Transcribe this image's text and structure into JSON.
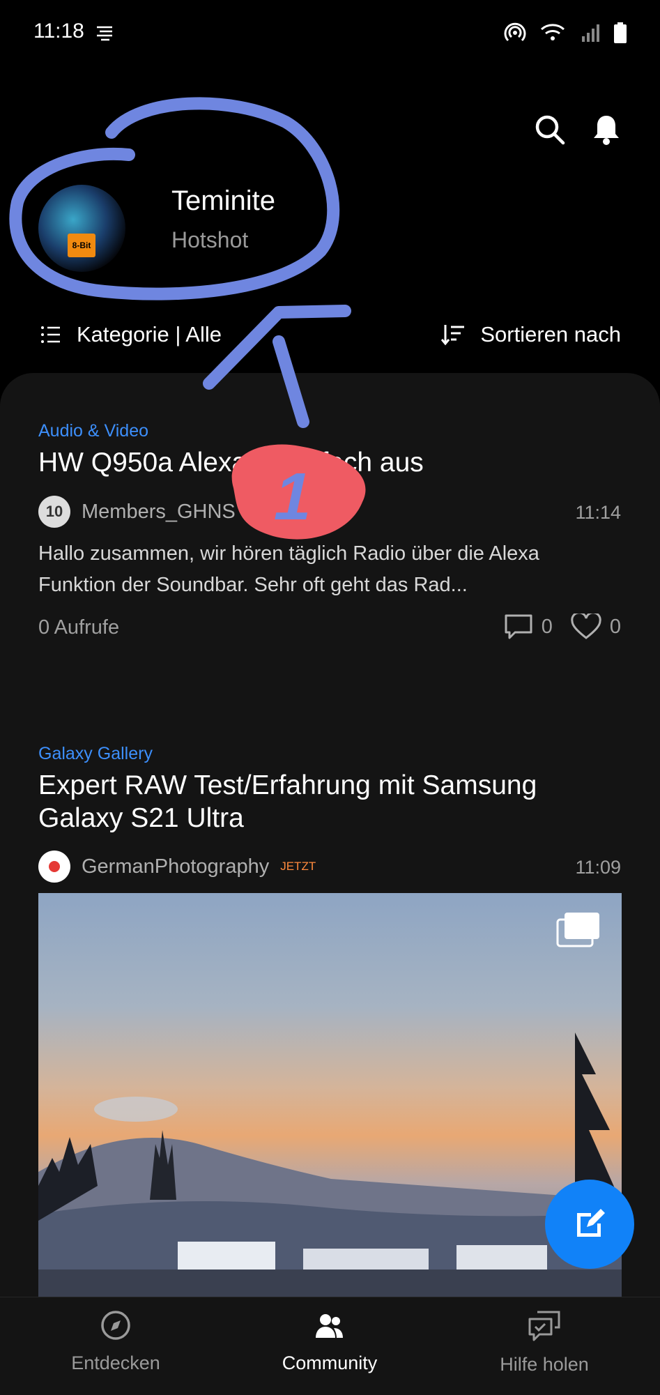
{
  "status_bar": {
    "time": "11:18"
  },
  "header": {
    "username": "Teminite",
    "rank": "Hotshot",
    "avatar_tag": "8-Bit"
  },
  "toolbar": {
    "category_label": "Kategorie | Alle",
    "sort_label": "Sortieren nach"
  },
  "posts": [
    {
      "category": "Audio & Video",
      "title": "HW Q950a Alexa ... einfach aus",
      "author": "Members_GHNS",
      "time": "11:14",
      "excerpt": "Hallo zusammen, wir hören täglich Radio über die Alexa Funktion der Soundbar. Sehr oft geht das Rad...",
      "views": "0 Aufrufe",
      "comments": "0",
      "likes": "0"
    },
    {
      "category": "Galaxy Gallery",
      "title": "Expert RAW Test/Erfahrung mit Samsung Galaxy S21 Ultra",
      "author": "GermanPhotography",
      "badge": "JETZT",
      "time": "11:09"
    }
  ],
  "annotation": {
    "number": "1"
  },
  "nav": {
    "items": [
      {
        "label": "Entdecken",
        "icon": "compass-icon",
        "active": false
      },
      {
        "label": "Community",
        "icon": "people-icon",
        "active": true
      },
      {
        "label": "Hilfe holen",
        "icon": "chat-help-icon",
        "active": false
      }
    ]
  },
  "colors": {
    "accent": "#1182f8",
    "category": "#3d8ffb",
    "annotation_blue": "#6f86e0",
    "annotation_red": "#ef5b63",
    "badge": "#ff8a3d"
  }
}
